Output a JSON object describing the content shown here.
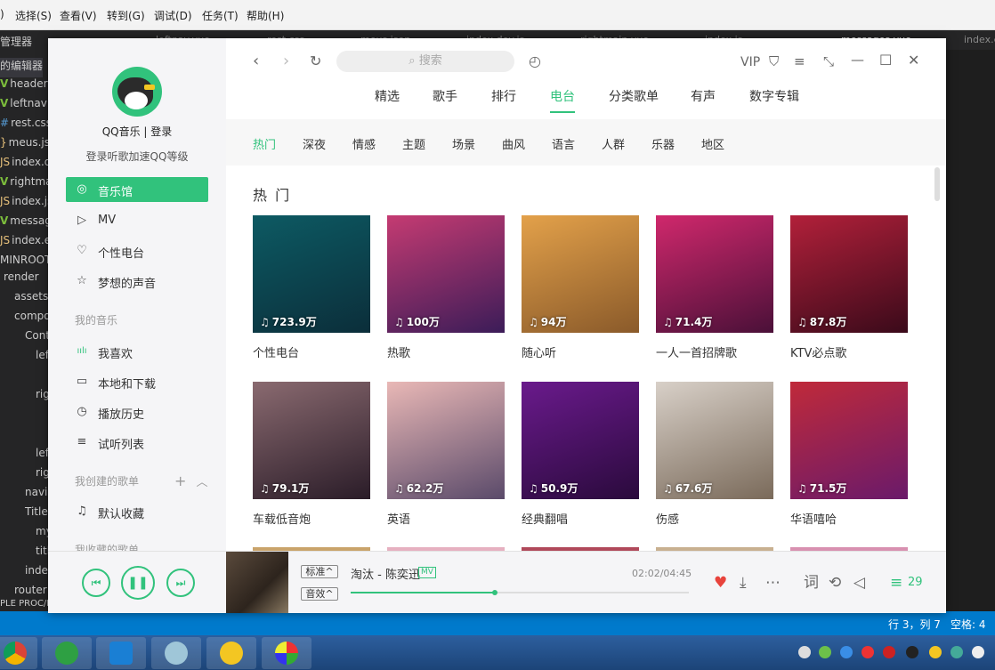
{
  "editor": {
    "menus": [
      ") ",
      "选择(S)",
      "查看(V)",
      "转到(G)",
      "调试(D)",
      "任务(T)",
      "帮助(H)"
    ],
    "tabs": [
      "leftnav.vue",
      "rest.css",
      "meus.json",
      "index.dev.js",
      "rightmain.vue",
      "index.js",
      "messages.vue",
      "index.ej"
    ],
    "sidebar_title": "管理器",
    "open_editors": "的编辑器",
    "files": [
      "header",
      "leftnav",
      "rest.css",
      "meus.js",
      "index.d",
      "rightma",
      "index.js",
      "messag",
      "index.e"
    ],
    "root": "MINROOT",
    "tree": [
      "render",
      "assets",
      "compo",
      "Cont",
      "lef",
      "rig",
      "lef",
      "rig",
      "navi",
      "Title",
      "my",
      "titl",
      "inde",
      "router"
    ],
    "bottom_path": "PLE PROC/M",
    "status_position": "行 3，列 7",
    "status_spaces": "空格: 4"
  },
  "app": {
    "name": "QQ音乐",
    "user": {
      "login_text": "QQ音乐 | 登录",
      "subtitle": "登录听歌加速QQ等级"
    },
    "sidebar": {
      "nav": [
        {
          "label": "音乐馆",
          "icon": "music-hall-icon",
          "glyph": "◎",
          "active": true
        },
        {
          "label": "MV",
          "icon": "mv-icon",
          "glyph": "▷",
          "active": false
        },
        {
          "label": "个性电台",
          "icon": "radio-heart-icon",
          "glyph": "♡",
          "active": false
        },
        {
          "label": "梦想的声音",
          "icon": "star-icon",
          "glyph": "☆",
          "active": false
        }
      ],
      "my_music_title": "我的音乐",
      "my_music": [
        {
          "label": "我喜欢",
          "icon": "equalizer-icon",
          "glyph": "ıılı"
        },
        {
          "label": "本地和下载",
          "icon": "monitor-icon",
          "glyph": "▭"
        },
        {
          "label": "播放历史",
          "icon": "clock-icon",
          "glyph": "◷"
        },
        {
          "label": "试听列表",
          "icon": "playlist-icon",
          "glyph": "≡"
        }
      ],
      "created_title": "我创建的歌单",
      "created": [
        {
          "label": "默认收藏",
          "icon": "note-icon",
          "glyph": "♫"
        }
      ],
      "collected_title": "我收藏的歌单"
    },
    "search_placeholder": "搜索",
    "vip_label": "VIP",
    "main_tabs": [
      "精选",
      "歌手",
      "排行",
      "电台",
      "分类歌单",
      "有声",
      "数字专辑"
    ],
    "active_main_tab": "电台",
    "sub_tabs": [
      "热门",
      "深夜",
      "情感",
      "主题",
      "场景",
      "曲风",
      "语言",
      "人群",
      "乐器",
      "地区"
    ],
    "active_sub_tab": "热门",
    "section_heading": "热 门",
    "cards": [
      {
        "title": "个性电台",
        "plays": "723.9万",
        "colors": [
          "#0d5a63",
          "#0b2e3a"
        ]
      },
      {
        "title": "热歌",
        "plays": "100万",
        "colors": [
          "#c53b72",
          "#3b1c58"
        ]
      },
      {
        "title": "随心听",
        "plays": "94万",
        "colors": [
          "#e3a14a",
          "#8a5a2a"
        ]
      },
      {
        "title": "一人一首招牌歌",
        "plays": "71.4万",
        "colors": [
          "#d0286c",
          "#4a1038"
        ]
      },
      {
        "title": "KTV必点歌",
        "plays": "87.8万",
        "colors": [
          "#b2203a",
          "#3a0a1a"
        ]
      },
      {
        "title": "车载低音炮",
        "plays": "79.1万",
        "colors": [
          "#8a6a70",
          "#2a1c28"
        ]
      },
      {
        "title": "英语",
        "plays": "62.2万",
        "colors": [
          "#e9b8b6",
          "#5a4a6a"
        ]
      },
      {
        "title": "经典翻唱",
        "plays": "50.9万",
        "colors": [
          "#6a1a8c",
          "#2a0a3c"
        ]
      },
      {
        "title": "伤感",
        "plays": "67.6万",
        "colors": [
          "#d8d0c8",
          "#7a6a5a"
        ]
      },
      {
        "title": "华语嘻哈",
        "plays": "71.5万",
        "colors": [
          "#c02a3a",
          "#6a1a6a"
        ]
      }
    ],
    "player": {
      "quality": "标准",
      "effect": "音效",
      "song": "淘汰 - 陈奕迅",
      "mv_badge": "MV",
      "time": "02:02/04:45",
      "progress": 0.427,
      "playlist_count": "29",
      "accent": "#31c27c",
      "heart_color": "#e8433c"
    }
  }
}
